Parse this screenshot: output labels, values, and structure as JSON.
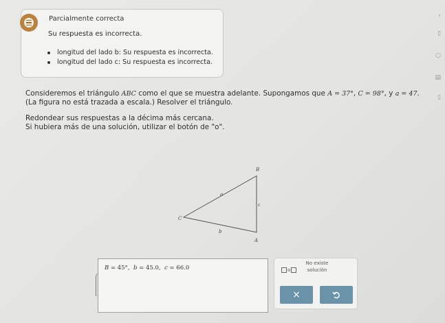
{
  "feedback": {
    "title": "Parcialmente correcta",
    "subtitle": "Su respuesta es incorrecta.",
    "items": [
      "longitud del lado b: Su respuesta es incorrecta.",
      "longitud del lado c: Su respuesta es incorrecta."
    ],
    "icon": "list-icon",
    "accent": "#b9823f"
  },
  "problem": {
    "line1_text": "Consideremos el triángulo ",
    "triangle_name": "ABC",
    "line1_mid": " como el que se muestra adelante. Supongamos que ",
    "given_A": "A = 37°",
    "given_C": "C = 98°",
    "given_y": ", y ",
    "given_a": "a = 47",
    "line1_end": ".",
    "line2": "(La figura no está trazada a escala.) Resolver el triángulo.",
    "line3": "Redondear sus respuestas a la décima más cercana.",
    "line4": "Si hubiera más de una solución, utilizar el botón de \"o\"."
  },
  "diagram": {
    "vertex_B": "B",
    "vertex_C": "C",
    "vertex_A": "A",
    "side_a": "a",
    "side_b": "b",
    "side_c": "c"
  },
  "answer": {
    "B_label": "B",
    "B_value": "45",
    "B_unit": "°",
    "b_label": "b",
    "b_value": "45.0",
    "c_label": "c",
    "c_value": "66.0"
  },
  "tools": {
    "or_label": "o",
    "no_solution": "No existe solución",
    "clear_icon": "close-icon",
    "undo_icon": "undo-icon",
    "clear_label": "×",
    "button_color": "#6a93a9"
  }
}
